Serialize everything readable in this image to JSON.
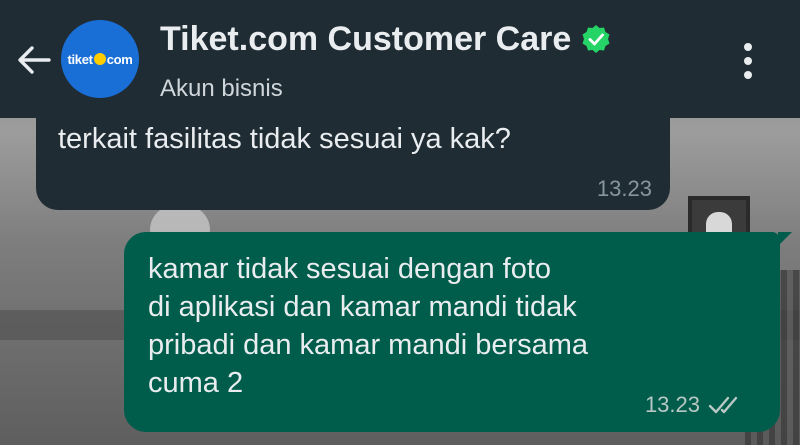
{
  "header": {
    "back_label": "back",
    "avatar_text_left": "tiket",
    "avatar_text_right": "com",
    "title": "Tiket.com Customer Care",
    "subtitle": "Akun bisnis"
  },
  "messages": {
    "incoming": {
      "text": "terkait fasilitas tidak sesuai ya kak?",
      "time": "13.23"
    },
    "outgoing": {
      "lines": [
        "kamar tidak sesuai dengan foto",
        "di aplikasi dan kamar mandi tidak",
        "pribadi dan kamar mandi bersama",
        "cuma 2"
      ],
      "time": "13.23",
      "status": "double-check-icon"
    }
  },
  "colors": {
    "header_bg": "#1f2c34",
    "incoming_bg": "#202c33",
    "outgoing_bg": "#005c4b",
    "verified": "#25d366",
    "avatar_bg": "#1a6fd6"
  }
}
